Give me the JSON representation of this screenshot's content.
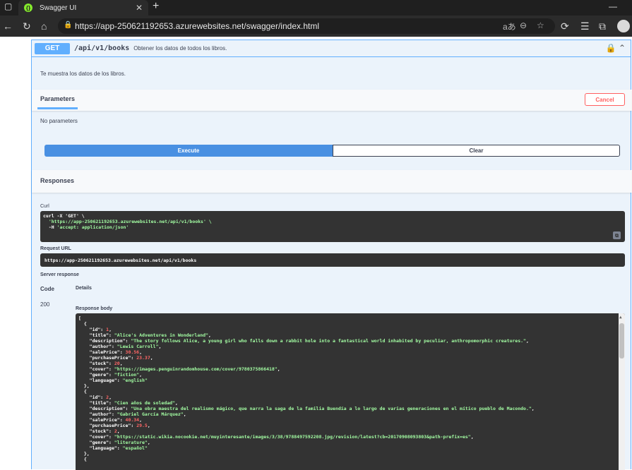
{
  "browser": {
    "tab_title": "Swagger UI",
    "favicon_text": "{}",
    "url": "https://app-250621192653.azurewebsites.net/swagger/index.html"
  },
  "operation": {
    "method": "GET",
    "path": "/api/v1/books",
    "summary": "Obtener los datos de todos los libros.",
    "description": "Te muestra los datos de los libros."
  },
  "parameters": {
    "tab_label": "Parameters",
    "cancel_label": "Cancel",
    "empty_text": "No parameters"
  },
  "actions": {
    "execute_label": "Execute",
    "clear_label": "Clear"
  },
  "responses": {
    "title": "Responses",
    "curl_label": "Curl",
    "curl_lines": [
      "curl -X 'GET' \\",
      "  'https://app-250621192653.azurewebsites.net/api/v1/books' \\",
      "  -H 'accept: application/json'"
    ],
    "request_url_label": "Request URL",
    "request_url": "https://app-250621192653.azurewebsites.net/api/v1/books",
    "server_response_label": "Server response",
    "code_header": "Code",
    "details_header": "Details",
    "status_code": "200",
    "response_body_label": "Response body",
    "books": [
      {
        "id": "1",
        "title": "\"Alice's Adventures in Wonderland\"",
        "description": "\"The story follows Alice, a young girl who falls down a rabbit hole into a fantastical world inhabited by peculiar, anthropomorphic creatures.\"",
        "author": "\"Lewis Carroll\"",
        "salePrice": "30.56",
        "purchasePrice": "23.37",
        "stock": "20",
        "cover": "\"https://images.penguinrandomhouse.com/cover/9780375866418\"",
        "genre": "\"fiction\"",
        "language": "\"english\""
      },
      {
        "id": "2",
        "title": "\"Cien años de soledad\"",
        "description": "\"Una obra maestra del realismo mágico, que narra la saga de la familia Buendía a lo largo de varias generaciones en el mítico pueblo de Macondo.\"",
        "author": "\"Gabriel García Márquez\"",
        "salePrice": "40.34",
        "purchasePrice": "29.5",
        "stock": "2",
        "cover": "\"https://static.wikia.nocookie.net/muyinteresante/images/3/38/9788497592208.jpg/revision/latest?cb=20170908093803&path-prefix=es\"",
        "genre": "\"literature\"",
        "language": "\"español\""
      }
    ]
  }
}
